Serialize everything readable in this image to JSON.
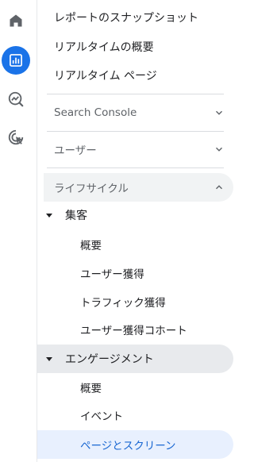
{
  "rail": {
    "icons": [
      "home-icon",
      "reports-icon",
      "explore-icon",
      "advertising-icon"
    ],
    "accent": "#1a73e8"
  },
  "nav": {
    "top_items": [
      "レポートのスナップショット",
      "リアルタイムの概要",
      "リアルタイム ページ"
    ],
    "sections": {
      "search_console": "Search Console",
      "user": "ユーザー",
      "lifecycle": "ライフサイクル"
    },
    "acquisition": {
      "label": "集客",
      "items": [
        "概要",
        "ユーザー獲得",
        "トラフィック獲得",
        "ユーザー獲得コホート"
      ]
    },
    "engagement": {
      "label": "エンゲージメント",
      "items": [
        "概要",
        "イベント",
        "ページとスクリーン"
      ]
    },
    "colors": {
      "selected_bg": "#e8f0fe",
      "selected_text": "#1967d2"
    }
  }
}
